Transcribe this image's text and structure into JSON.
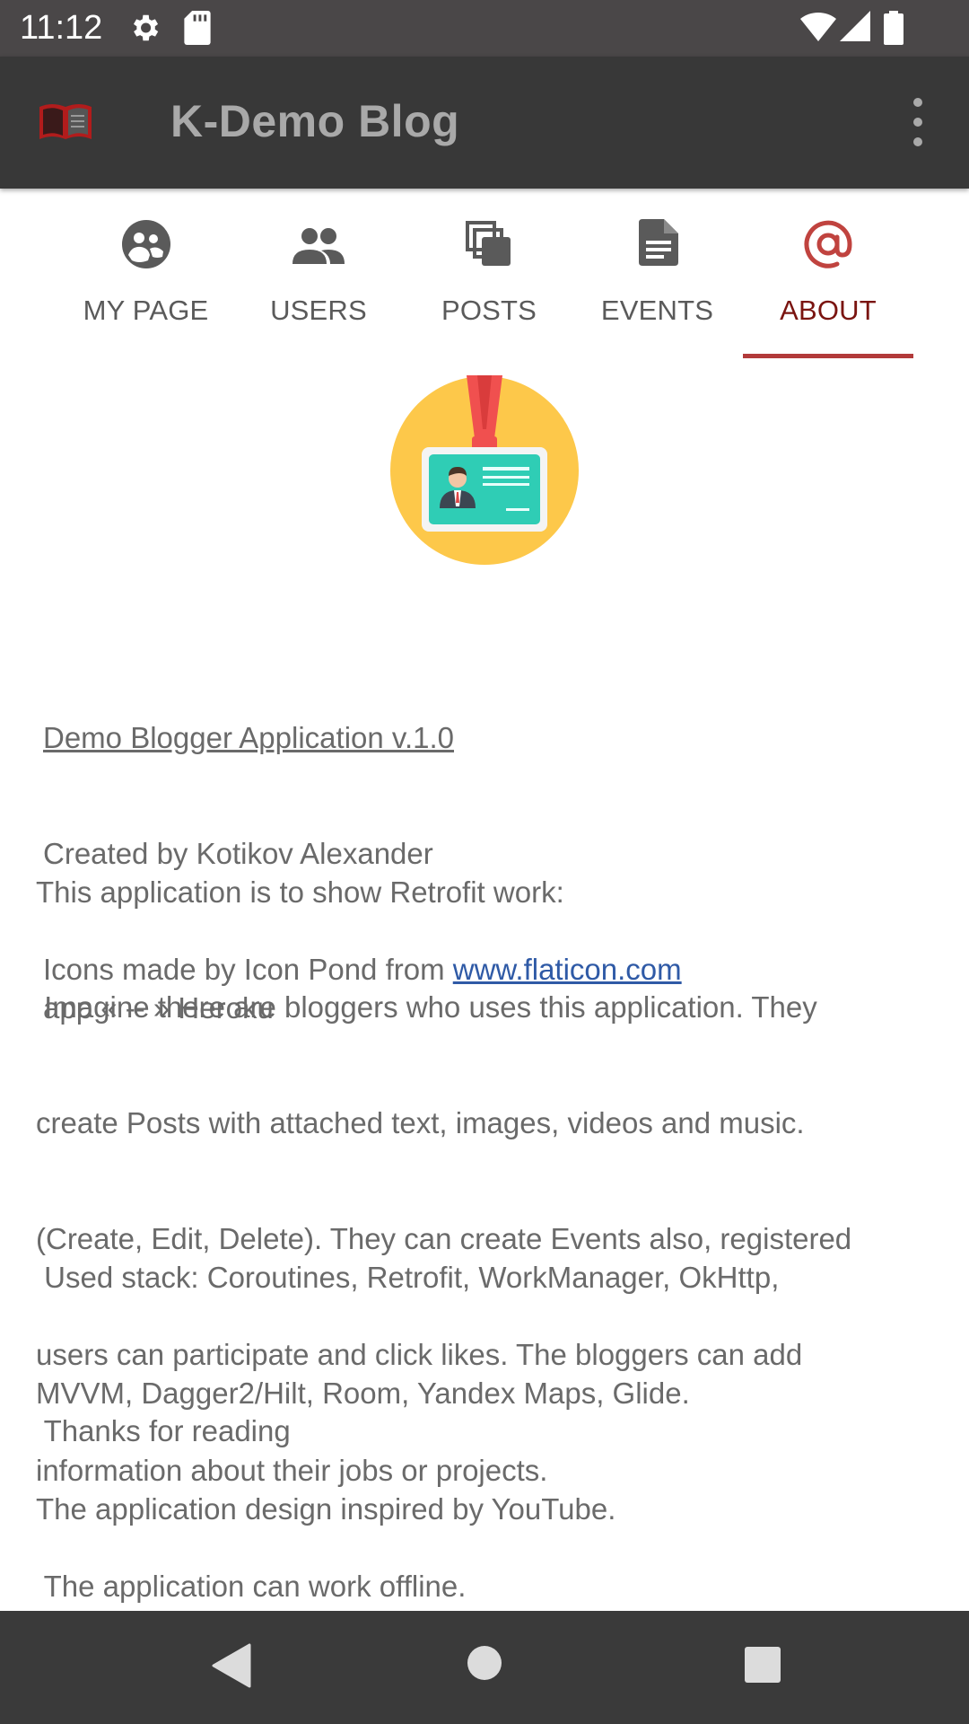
{
  "status_bar": {
    "time": "11:12"
  },
  "app_bar": {
    "title": "K-Demo Blog"
  },
  "tabs": [
    {
      "label": "MY PAGE",
      "icon": "my-page-icon"
    },
    {
      "label": "USERS",
      "icon": "users-icon"
    },
    {
      "label": "POSTS",
      "icon": "posts-icon"
    },
    {
      "label": "EVENTS",
      "icon": "events-icon"
    },
    {
      "label": "ABOUT",
      "icon": "at-sign-icon",
      "active": true
    }
  ],
  "about": {
    "app_name_link": "Demo Blogger Application v.1.0",
    "created_by": "Created by Kotikov Alexander",
    "icons_credit_prefix": "Icons made by Icon Pond from ",
    "icons_credit_link": "www.flaticon.com",
    "purpose_line1": "This application is to show Retrofit work:",
    "purpose_line2": "app « -- » Heroku",
    "desc_line1": " Imagine there are bloggers who uses this application. They",
    "desc_line2": "create Posts with attached text, images, videos and music.",
    "desc_line3": "(Create, Edit, Delete). They can create Events also, registered",
    "desc_line4": "users can participate and click likes. The bloggers can add",
    "desc_line5": "information about their jobs or projects.",
    "desc_line6": " The application can work offline.",
    "stack_line1": " Used stack: Coroutines, Retrofit, WorkManager, OkHttp,",
    "stack_line2": "MVVM, Dagger2/Hilt, Room, Yandex Maps, Glide.",
    "stack_line3": "The application design inspired by YouTube.",
    "thanks": " Thanks for reading"
  },
  "colors": {
    "accent": "#b23a3a",
    "active_tab_text": "#7a1410",
    "app_bar": "#383838",
    "link": "#2f5aa6"
  }
}
